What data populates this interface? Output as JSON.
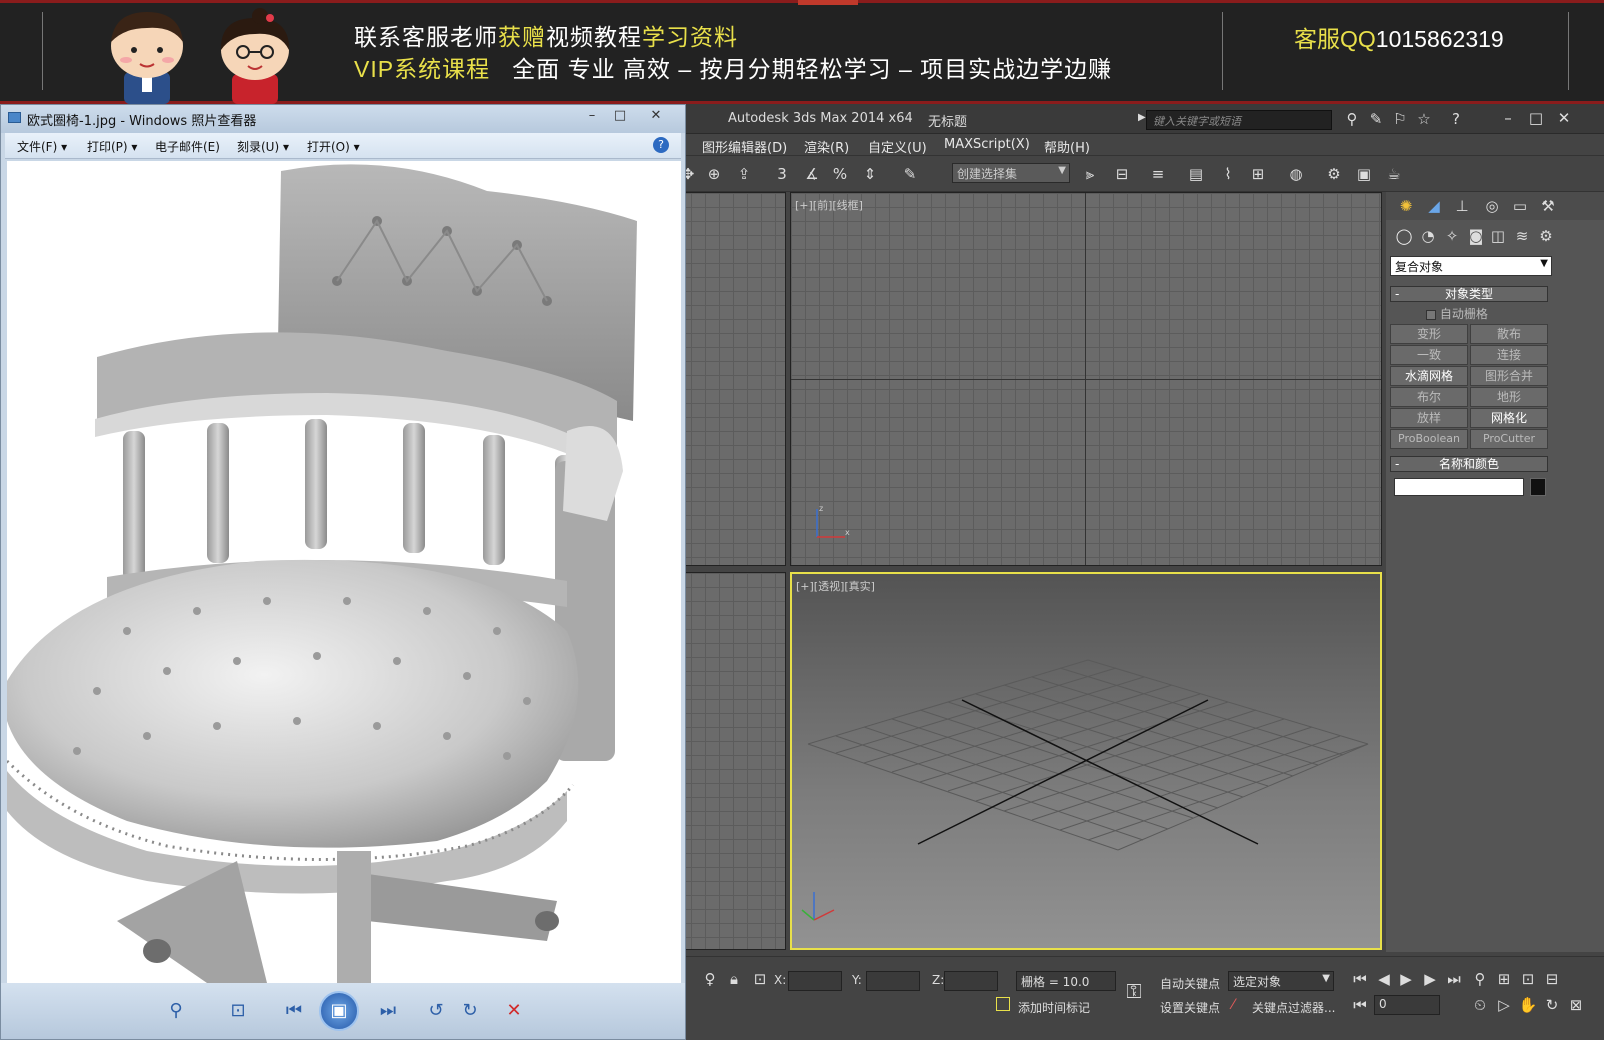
{
  "banner": {
    "line1_a": "联系客服老师",
    "line1_b": "获赠",
    "line1_c": "视频教程",
    "line1_d": "学习资料",
    "line2_a": "VIP系统课程",
    "line2_b": "全面 专业 高效 – 按月分期轻松学习 – 项目实战边学边赚",
    "qq_label": "客服QQ",
    "qq_number": "1015862319"
  },
  "photo_viewer": {
    "title": "欧式圈椅-1.jpg - Windows 照片查看器",
    "menu": [
      {
        "label": "文件(F)"
      },
      {
        "label": "打印(P)"
      },
      {
        "label": "电子邮件(E)"
      },
      {
        "label": "刻录(U)"
      },
      {
        "label": "打开(O)"
      }
    ],
    "help_icon": "?"
  },
  "max": {
    "title": "Autodesk 3ds Max  2014 x64",
    "doc_title": "无标题",
    "search_placeholder": "键入关键字或短语",
    "menu": [
      {
        "label": "图形编辑器(D)"
      },
      {
        "label": "渲染(R)"
      },
      {
        "label": "自定义(U)"
      },
      {
        "label": "MAXScript(X)"
      },
      {
        "label": "帮助(H)"
      }
    ],
    "selection_set": "创建选择集",
    "viewport_top_label": "[+][前][线框]",
    "viewport_persp_label": "[+][透视][真实]",
    "command_panel": {
      "dropdown": "复合对象",
      "rollout_object_type": "对象类型",
      "auto_grid": "自动栅格",
      "buttons": [
        {
          "label": "变形"
        },
        {
          "label": "散布"
        },
        {
          "label": "一致"
        },
        {
          "label": "连接"
        },
        {
          "label": "水滴网格"
        },
        {
          "label": "图形合并"
        },
        {
          "label": "布尔"
        },
        {
          "label": "地形"
        },
        {
          "label": "放样"
        },
        {
          "label": "网格化"
        },
        {
          "label": "ProBoolean"
        },
        {
          "label": "ProCutter"
        }
      ],
      "rollout_name_color": "名称和颜色"
    },
    "status": {
      "x_label": "X:",
      "y_label": "Y:",
      "z_label": "Z:",
      "grid": "栅格 = 10.0",
      "add_time_tag": "添加时间标记",
      "auto_key": "自动关键点",
      "set_key": "设置关键点",
      "selected_object": "选定对象",
      "key_filter": "关键点过滤器...",
      "frame": "0"
    }
  }
}
